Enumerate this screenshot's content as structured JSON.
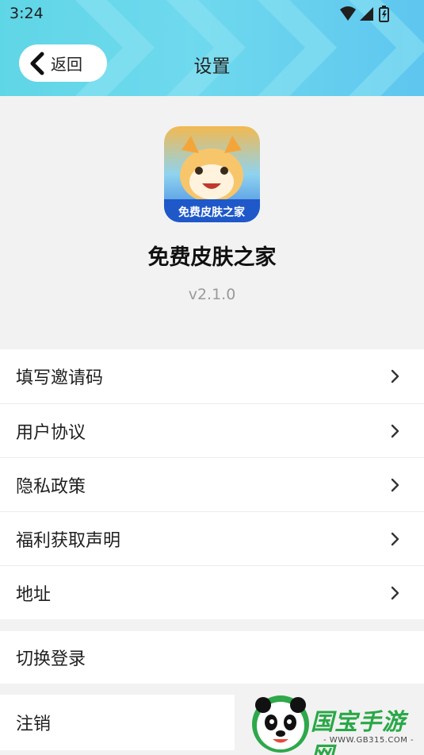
{
  "status_bar": {
    "time": "3:24",
    "icons": [
      "wifi-icon",
      "signal-icon",
      "battery-icon"
    ]
  },
  "header": {
    "back_label": "返回",
    "title": "设置",
    "colors": {
      "gradient_start": "#5fd6e6",
      "gradient_end": "#5ec6ef"
    }
  },
  "app": {
    "icon_caption": "免费皮肤之家",
    "name": "免费皮肤之家",
    "version": "v2.1.0"
  },
  "menu_group": [
    {
      "label": "填写邀请码"
    },
    {
      "label": "用户协议"
    },
    {
      "label": "隐私政策"
    },
    {
      "label": "福利获取声明"
    },
    {
      "label": "地址"
    }
  ],
  "switch_login": {
    "label": "切换登录"
  },
  "logout": {
    "label": "注销"
  },
  "watermark": {
    "brand": "国宝手游网",
    "url": "- WWW.GB315.COM -"
  }
}
